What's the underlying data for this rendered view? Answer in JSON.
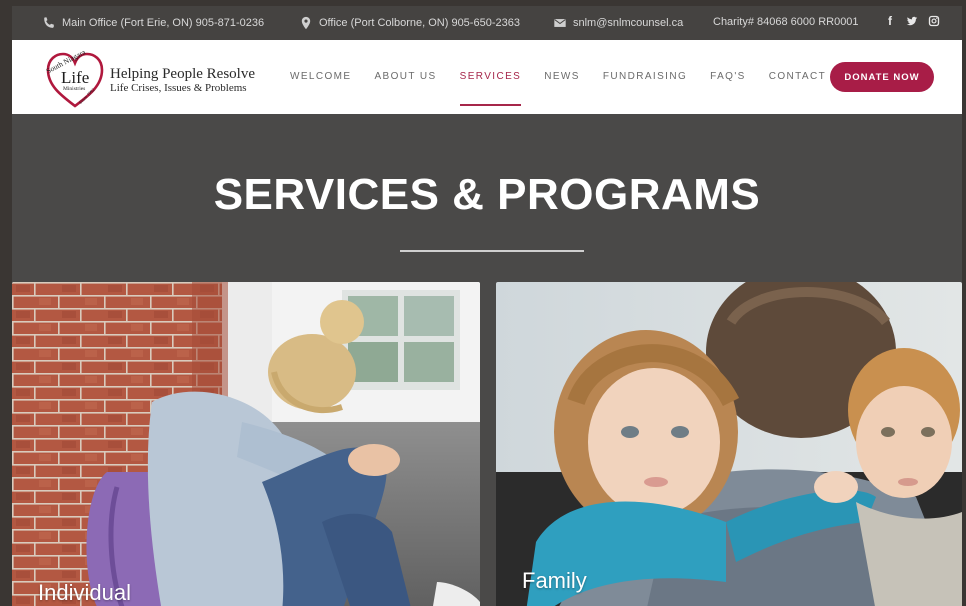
{
  "topbar": {
    "main_office": "Main Office (Fort Erie, ON) 905-871-0236",
    "office": "Office (Port Colborne, ON) 905-650-2363",
    "email": "snlm@snlmcounsel.ca",
    "charity": "Charity# 84068 6000 RR0001",
    "social": [
      "facebook-icon",
      "twitter-icon",
      "instagram-icon"
    ]
  },
  "logo": {
    "arc_text": "South Niagara",
    "word": "Life",
    "sub": "Ministries",
    "since": "Since 1992",
    "tagline1": "Helping People Resolve",
    "tagline2": "Life Crises, Issues & Problems"
  },
  "nav": {
    "items": [
      {
        "label": "WELCOME"
      },
      {
        "label": "ABOUT US"
      },
      {
        "label": "SERVICES",
        "active": true
      },
      {
        "label": "NEWS"
      },
      {
        "label": "FUNDRAISING"
      },
      {
        "label": "FAQ'S"
      },
      {
        "label": "CONTACT US"
      }
    ],
    "donate": "DONATE NOW"
  },
  "hero": {
    "title": "SERVICES & PROGRAMS"
  },
  "cards": [
    {
      "label": "Individual"
    },
    {
      "label": "Family"
    }
  ],
  "colors": {
    "accent": "#a81d47",
    "topbar": "#454341",
    "hero": "#4a4948"
  }
}
